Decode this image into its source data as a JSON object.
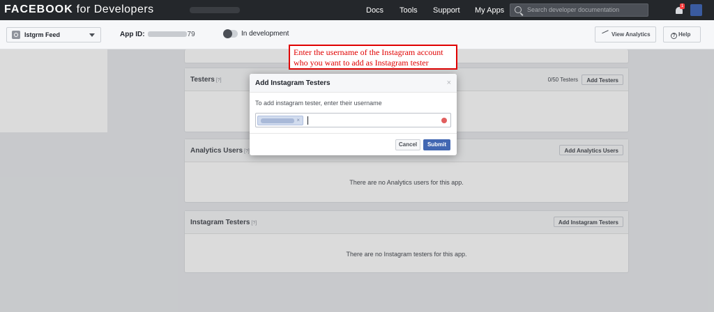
{
  "topbar": {
    "brand_bold": "FACEBOOK",
    "brand_light": " for Developers",
    "nav": [
      "Docs",
      "Tools",
      "Support",
      "My Apps"
    ],
    "search_placeholder": "Search developer documentation",
    "notification_count": "1"
  },
  "subbar": {
    "app_name": "Istgrm Feed",
    "app_id_label": "App ID:",
    "app_id_visible_suffix": "79",
    "status_label": "In development",
    "view_analytics": "View Analytics",
    "help": "Help"
  },
  "callout": {
    "line1": "Enter the username of the Instagram account",
    "line2": "who you want to add as Instagram tester"
  },
  "sections": {
    "testers": {
      "title": "Testers",
      "help": "[?]",
      "count": "0/50 Testers",
      "button": "Add Testers"
    },
    "analytics_users": {
      "title": "Analytics Users",
      "help": "[?]",
      "button": "Add Analytics Users",
      "empty": "There are no Analytics users for this app."
    },
    "instagram_testers": {
      "title": "Instagram Testers",
      "help": "[?]",
      "button": "Add Instagram Testers",
      "empty": "There are no Instagram testers for this app."
    }
  },
  "modal": {
    "title": "Add Instagram Testers",
    "close": "×",
    "message": "To add instagram tester, enter their username",
    "token_remove": "×",
    "cancel": "Cancel",
    "submit": "Submit"
  }
}
